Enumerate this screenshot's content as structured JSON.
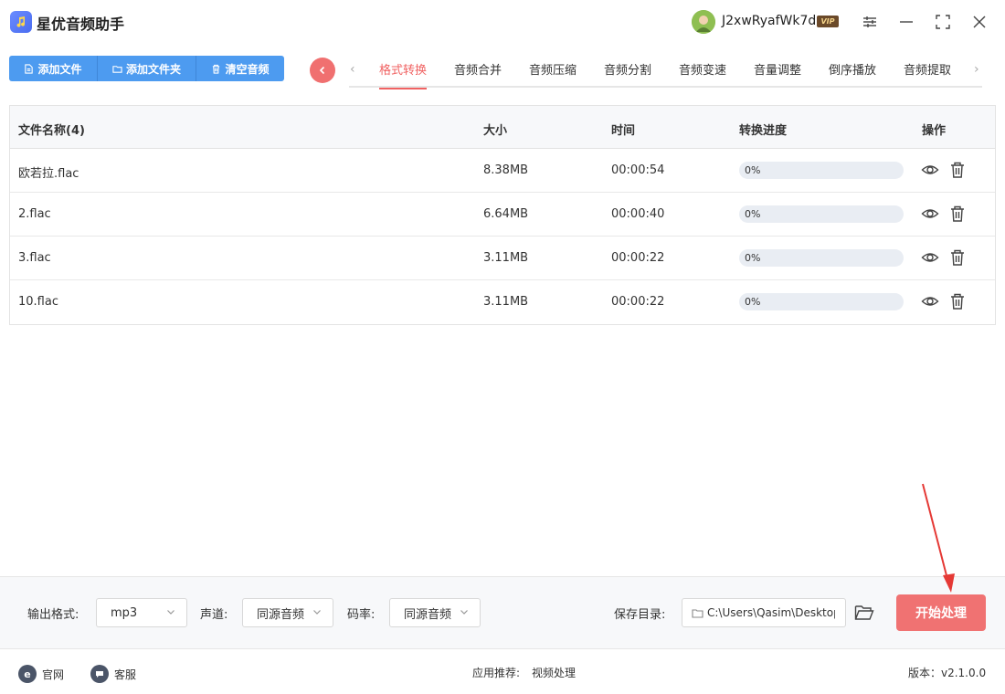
{
  "app": {
    "title": "星优音频助手"
  },
  "user": {
    "name": "J2xwRyafWk7d",
    "vip": "VIP"
  },
  "toolbar": {
    "add_file": "添加文件",
    "add_folder": "添加文件夹",
    "clear": "清空音频"
  },
  "tabs": [
    {
      "label": "格式转换",
      "active": true
    },
    {
      "label": "音频合并"
    },
    {
      "label": "音频压缩"
    },
    {
      "label": "音频分割"
    },
    {
      "label": "音频变速"
    },
    {
      "label": "音量调整"
    },
    {
      "label": "倒序播放"
    },
    {
      "label": "音频提取"
    }
  ],
  "table": {
    "headers": {
      "name": "文件名称(4)",
      "size": "大小",
      "time": "时间",
      "progress": "转换进度",
      "ops": "操作"
    },
    "rows": [
      {
        "name": "欧若拉.flac",
        "size": "8.38MB",
        "time": "00:00:54",
        "progress": "0%",
        "progress_value": 0
      },
      {
        "name": "2.flac",
        "size": "6.64MB",
        "time": "00:00:40",
        "progress": "0%",
        "progress_value": 0
      },
      {
        "name": "3.flac",
        "size": "3.11MB",
        "time": "00:00:22",
        "progress": "0%",
        "progress_value": 0
      },
      {
        "name": "10.flac",
        "size": "3.11MB",
        "time": "00:00:22",
        "progress": "0%",
        "progress_value": 0
      }
    ]
  },
  "settings": {
    "format_label": "输出格式:",
    "format_value": "mp3",
    "channel_label": "声道:",
    "channel_value": "同源音频",
    "bitrate_label": "码率:",
    "bitrate_value": "同源音频",
    "save_label": "保存目录:",
    "save_path": "C:\\Users\\Qasim\\Desktop",
    "start_label": "开始处理"
  },
  "footer": {
    "website": "官网",
    "service": "客服",
    "recommend_label": "应用推荐:",
    "recommend_value": "视频处理",
    "version": "版本：v2.1.0.0"
  },
  "colors": {
    "accent_red": "#f07070",
    "accent_blue": "#4d9bf0"
  }
}
